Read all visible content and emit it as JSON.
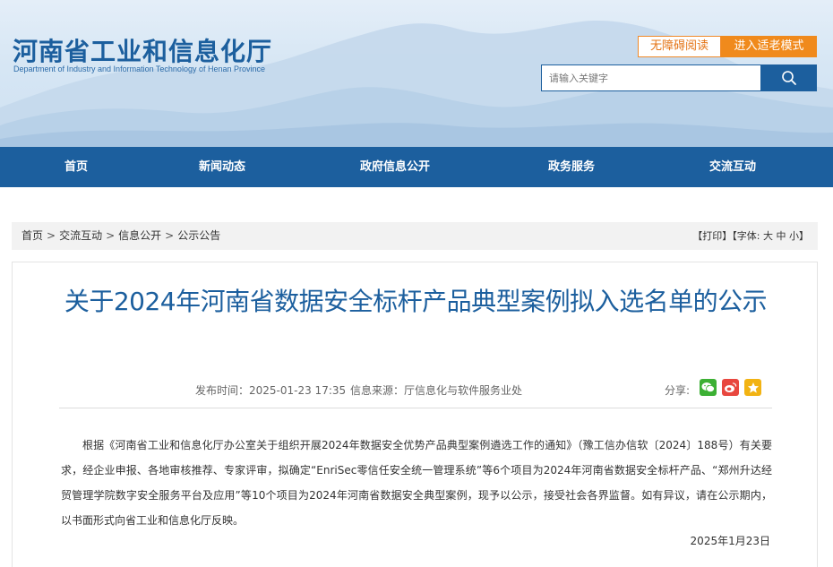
{
  "header": {
    "logo_cn": "河南省工业和信息化厅",
    "logo_en": "Department of Industry and Information Technology of Henan Province",
    "accessible_label": "无障碍阅读",
    "elder_mode_label": "进入适老模式",
    "search_placeholder": "请输入关键字"
  },
  "nav": {
    "items": [
      {
        "label": "首页"
      },
      {
        "label": "新闻动态"
      },
      {
        "label": "政府信息公开"
      },
      {
        "label": "政务服务"
      },
      {
        "label": "交流互动"
      }
    ]
  },
  "breadcrumb": {
    "items": [
      "首页",
      "交流互动",
      "信息公开",
      "公示公告"
    ],
    "separator": ">"
  },
  "tools": {
    "print": "【打印】",
    "font_prefix": "【字体:",
    "font_large": "大",
    "font_medium": "中",
    "font_small": "小",
    "font_suffix": "】"
  },
  "article": {
    "title": "关于2024年河南省数据安全标杆产品典型案例拟入选名单的公示",
    "publish_time": "发布时间：2025-01-23 17:35",
    "source": "信息来源：厅信息化与软件服务业处",
    "share_label": "分享:",
    "body": "根据《河南省工业和信息化厅办公室关于组织开展2024年数据安全优势产品典型案例遴选工作的通知》（豫工信办信软〔2024〕188号）有关要求，经企业申报、各地审核推荐、专家评审，拟确定“EnriSec零信任安全统一管理系统”等6个项目为2024年河南省数据安全标杆产品、“郑州升达经贸管理学院数字安全服务平台及应用”等10个项目为2024年河南省数据安全典型案例，现予以公示，接受社会各界监督。如有异议，请在公示期内，以书面形式向省工业和信息化厅反映。",
    "date": "2025年1月23日"
  },
  "colors": {
    "brand_blue": "#1c5f9e",
    "accent_orange": "#f08a1c",
    "wechat_green": "#3cb034",
    "weibo_red": "#e8473f",
    "qzone_yellow": "#f2b313"
  }
}
